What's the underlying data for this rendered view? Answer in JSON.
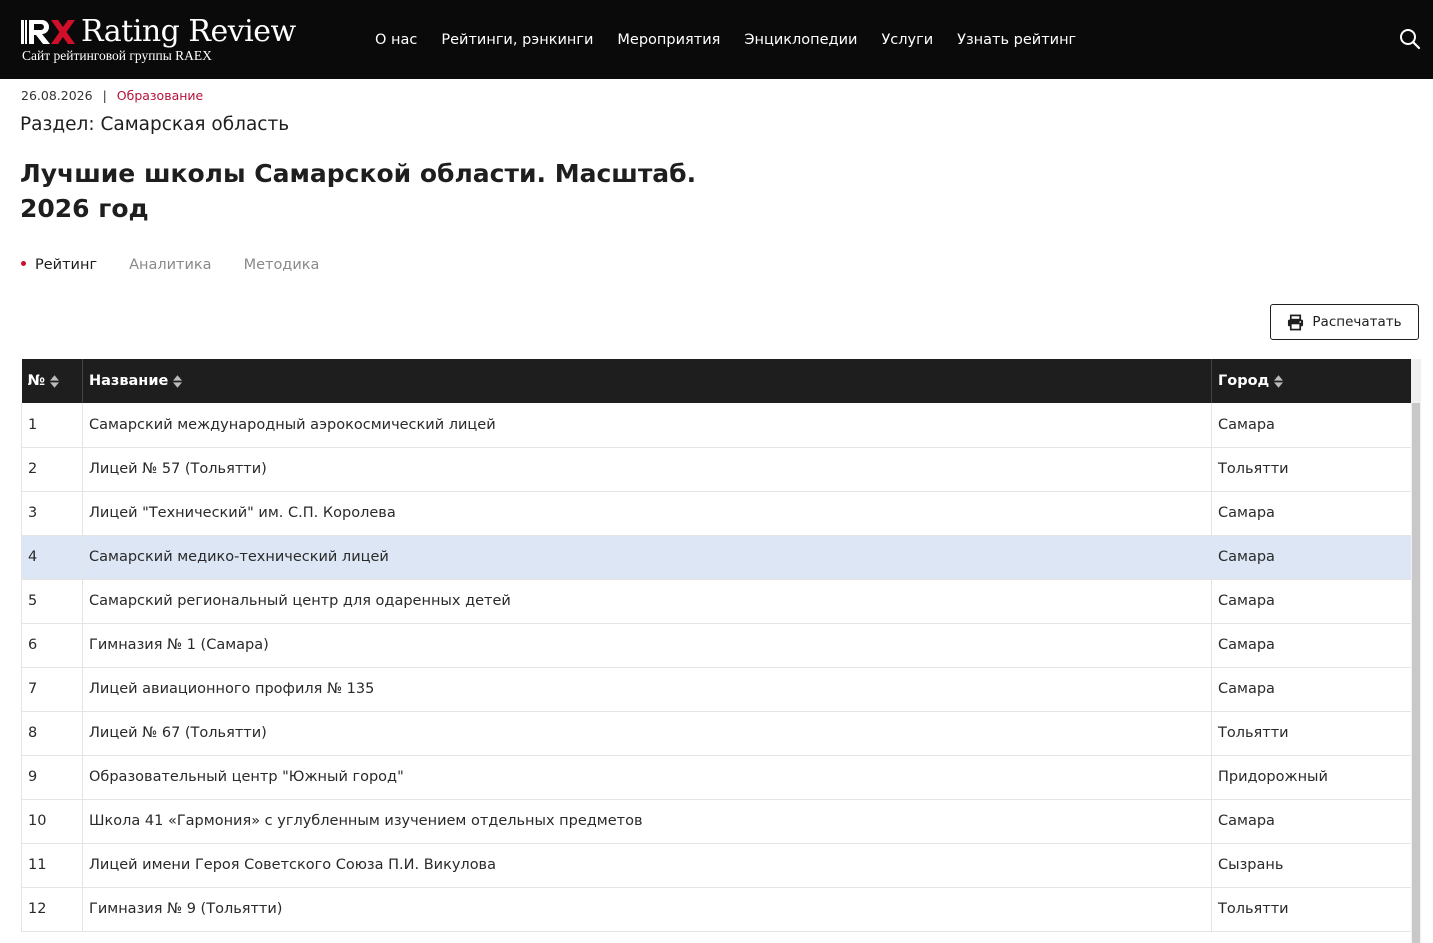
{
  "header": {
    "logo_mark": "RX",
    "logo_title": "Rating Review",
    "logo_subtitle": "Сайт рейтинговой группы RAEX",
    "nav": [
      "О нас",
      "Рейтинги, рэнкинги",
      "Мероприятия",
      "Энциклопедии",
      "Услуги",
      "Узнать рейтинг"
    ],
    "search_icon": "search-icon"
  },
  "article": {
    "date": "26.08.2026",
    "separator": "|",
    "category": "Образование",
    "section": "Раздел: Самарская область",
    "title": "Лучшие школы Самарской области. Масштаб. 2026 год",
    "tabs": [
      "Рейтинг",
      "Аналитика",
      "Методика"
    ],
    "active_tab": "Рейтинг"
  },
  "print_button": {
    "label": "Распечатать",
    "icon": "printer-icon"
  },
  "table": {
    "columns": [
      "№",
      "Название",
      "Город"
    ],
    "rows": [
      [
        "1",
        "Самарский международный аэрокосмический лицей",
        "Самара"
      ],
      [
        "2",
        "Лицей № 57 (Тольятти)",
        "Тольятти"
      ],
      [
        "3",
        "Лицей \"Технический\" им. С.П. Королева",
        "Самара"
      ],
      [
        "4",
        "Самарский медико-технический лицей",
        "Самара"
      ],
      [
        "5",
        "Самарский региональный центр для одаренных детей",
        "Самара"
      ],
      [
        "6",
        "Гимназия № 1 (Самара)",
        "Самара"
      ],
      [
        "7",
        "Лицей авиационного профиля № 135",
        "Самара"
      ],
      [
        "8",
        "Лицей № 67 (Тольятти)",
        "Тольятти"
      ],
      [
        "9",
        "Образовательный центр \"Южный город\"",
        "Придорожный"
      ],
      [
        "10",
        "Школа 41 «Гармония» с углубленным изучением отдельных предметов",
        "Самара"
      ],
      [
        "11",
        "Лицей имени Героя Советского Союза П.И. Викулова",
        "Сызрань"
      ],
      [
        "12",
        "Гимназия № 9 (Тольятти)",
        "Тольятти"
      ]
    ],
    "highlighted_row": "4"
  },
  "colors": {
    "header_bg": "#0a0a0a",
    "accent": "#c8102e",
    "table_header_bg": "#1e1e1e",
    "row_highlight": "#dde6f5"
  }
}
